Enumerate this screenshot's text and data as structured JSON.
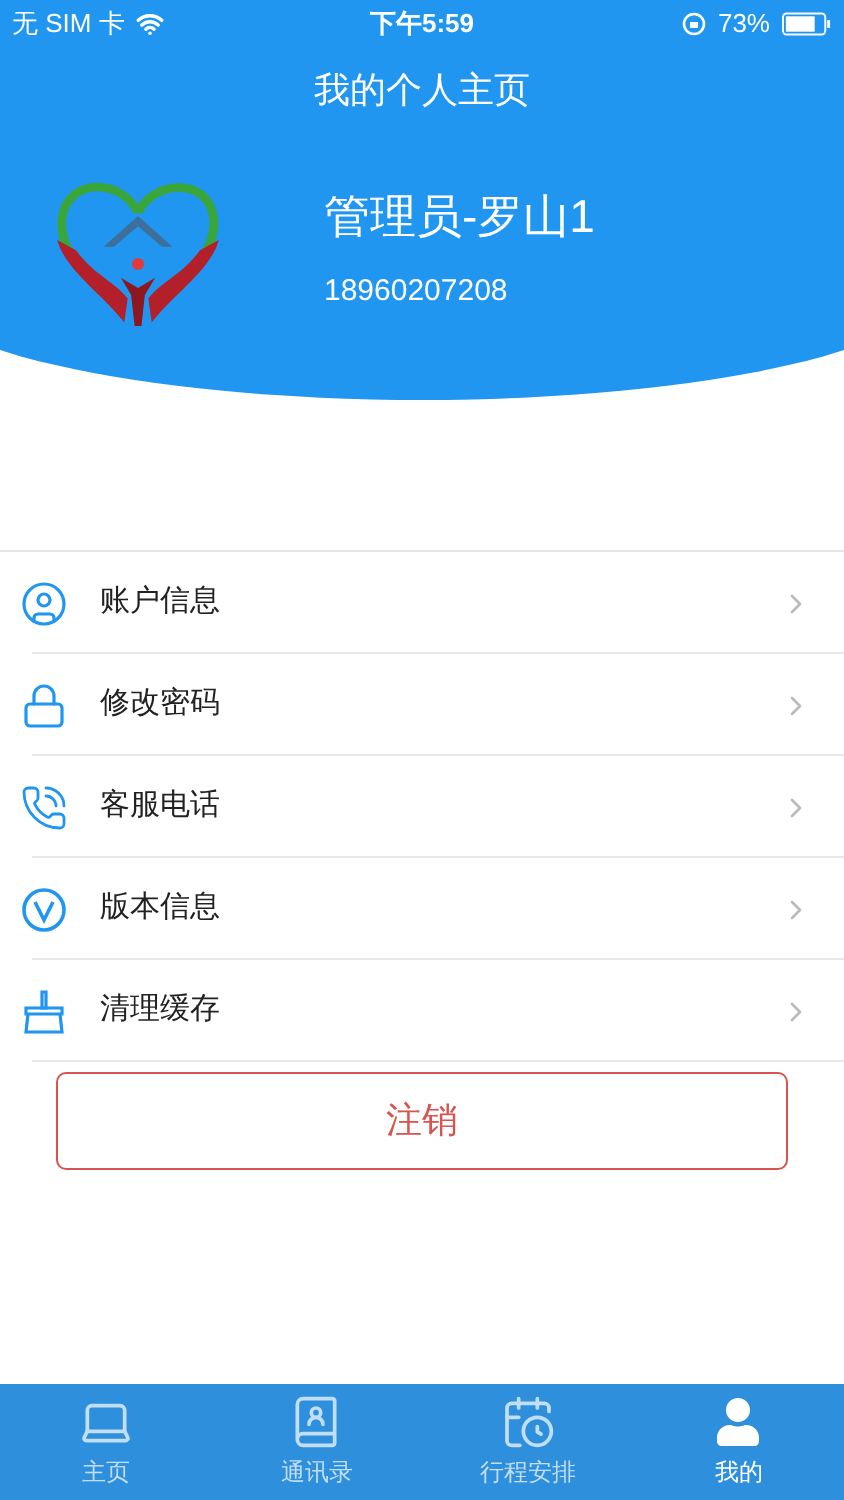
{
  "status_bar": {
    "carrier": "无 SIM 卡",
    "time": "下午5:59",
    "battery": "73%"
  },
  "title": "我的个人主页",
  "profile": {
    "name": "管理员-罗山1",
    "phone": "18960207208"
  },
  "menu": [
    {
      "kind": "account",
      "label": "账户信息"
    },
    {
      "kind": "password",
      "label": "修改密码"
    },
    {
      "kind": "phone",
      "label": "客服电话"
    },
    {
      "kind": "version",
      "label": "版本信息"
    },
    {
      "kind": "cache",
      "label": "清理缓存"
    }
  ],
  "logout_button": "注销",
  "tabs": [
    {
      "kind": "home",
      "label": "主页",
      "selected": false
    },
    {
      "kind": "contacts",
      "label": "通讯录",
      "selected": false
    },
    {
      "kind": "schedule",
      "label": "行程安排",
      "selected": false
    },
    {
      "kind": "me",
      "label": "我的",
      "selected": true
    }
  ]
}
